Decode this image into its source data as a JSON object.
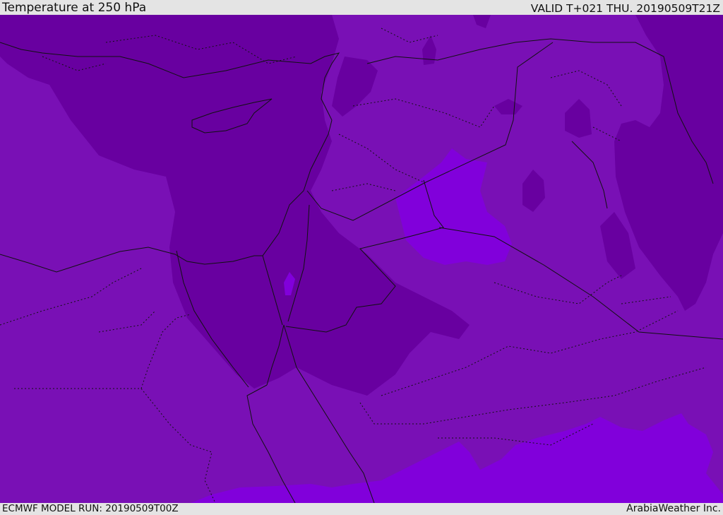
{
  "header": {
    "title": "Temperature at 250 hPa",
    "valid": "VALID T+021 THU. 20190509T21Z"
  },
  "footer": {
    "model_run": "ECMWF MODEL RUN: 20190509T00Z",
    "credit": "ArabiaWeather Inc."
  },
  "map": {
    "field_colors": {
      "base": "#7910b5",
      "dark": "#6800a0",
      "light": "#8100db"
    },
    "line_color": "#111111"
  }
}
